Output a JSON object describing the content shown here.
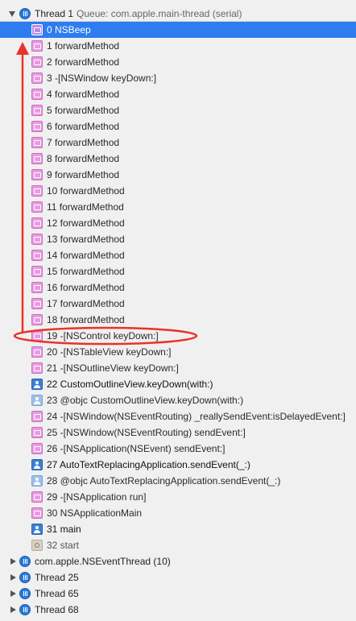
{
  "accent_color": "#2d7cf0",
  "annotation_color": "#e8332a",
  "thread_main": {
    "label": "Thread 1",
    "queue": "Queue: com.apple.main-thread (serial)",
    "expanded": true
  },
  "frames": [
    {
      "text": "0 NSBeep",
      "icon": "library-frame-icon",
      "selected": true
    },
    {
      "text": "1 forwardMethod",
      "icon": "library-frame-icon"
    },
    {
      "text": "2 forwardMethod",
      "icon": "library-frame-icon"
    },
    {
      "text": "3 -[NSWindow keyDown:]",
      "icon": "library-frame-icon"
    },
    {
      "text": "4 forwardMethod",
      "icon": "library-frame-icon"
    },
    {
      "text": "5 forwardMethod",
      "icon": "library-frame-icon"
    },
    {
      "text": "6 forwardMethod",
      "icon": "library-frame-icon"
    },
    {
      "text": "7 forwardMethod",
      "icon": "library-frame-icon"
    },
    {
      "text": "8 forwardMethod",
      "icon": "library-frame-icon"
    },
    {
      "text": "9 forwardMethod",
      "icon": "library-frame-icon"
    },
    {
      "text": "10 forwardMethod",
      "icon": "library-frame-icon"
    },
    {
      "text": "11 forwardMethod",
      "icon": "library-frame-icon"
    },
    {
      "text": "12 forwardMethod",
      "icon": "library-frame-icon"
    },
    {
      "text": "13 forwardMethod",
      "icon": "library-frame-icon"
    },
    {
      "text": "14 forwardMethod",
      "icon": "library-frame-icon"
    },
    {
      "text": "15 forwardMethod",
      "icon": "library-frame-icon"
    },
    {
      "text": "16 forwardMethod",
      "icon": "library-frame-icon"
    },
    {
      "text": "17 forwardMethod",
      "icon": "library-frame-icon"
    },
    {
      "text": "18 forwardMethod",
      "icon": "library-frame-icon"
    },
    {
      "text": "19 -[NSControl keyDown:]",
      "icon": "library-frame-icon",
      "circled": true
    },
    {
      "text": "20 -[NSTableView keyDown:]",
      "icon": "library-frame-icon"
    },
    {
      "text": "21 -[NSOutlineView keyDown:]",
      "icon": "library-frame-icon"
    },
    {
      "text": "22 CustomOutlineView.keyDown(with:)",
      "icon": "user-frame-icon",
      "bold": true
    },
    {
      "text": "23 @objc CustomOutlineView.keyDown(with:)",
      "icon": "user-frame-light-icon"
    },
    {
      "text": "24 -[NSWindow(NSEventRouting) _reallySendEvent:isDelayedEvent:]",
      "icon": "library-frame-icon"
    },
    {
      "text": "25 -[NSWindow(NSEventRouting) sendEvent:]",
      "icon": "library-frame-icon"
    },
    {
      "text": "26 -[NSApplication(NSEvent) sendEvent:]",
      "icon": "library-frame-icon"
    },
    {
      "text": "27 AutoTextReplacingApplication.sendEvent(_:)",
      "icon": "user-frame-icon",
      "bold": true
    },
    {
      "text": "28 @objc AutoTextReplacingApplication.sendEvent(_:)",
      "icon": "user-frame-light-icon"
    },
    {
      "text": "29 -[NSApplication run]",
      "icon": "library-frame-icon"
    },
    {
      "text": "30 NSApplicationMain",
      "icon": "library-frame-icon"
    },
    {
      "text": "31 main",
      "icon": "user-frame-icon",
      "bold": true
    },
    {
      "text": "32 start",
      "icon": "gear-frame-icon",
      "dim": true
    }
  ],
  "other_threads": [
    {
      "label": "com.apple.NSEventThread (10)"
    },
    {
      "label": "Thread 25"
    },
    {
      "label": "Thread 65"
    },
    {
      "label": "Thread 68"
    }
  ]
}
